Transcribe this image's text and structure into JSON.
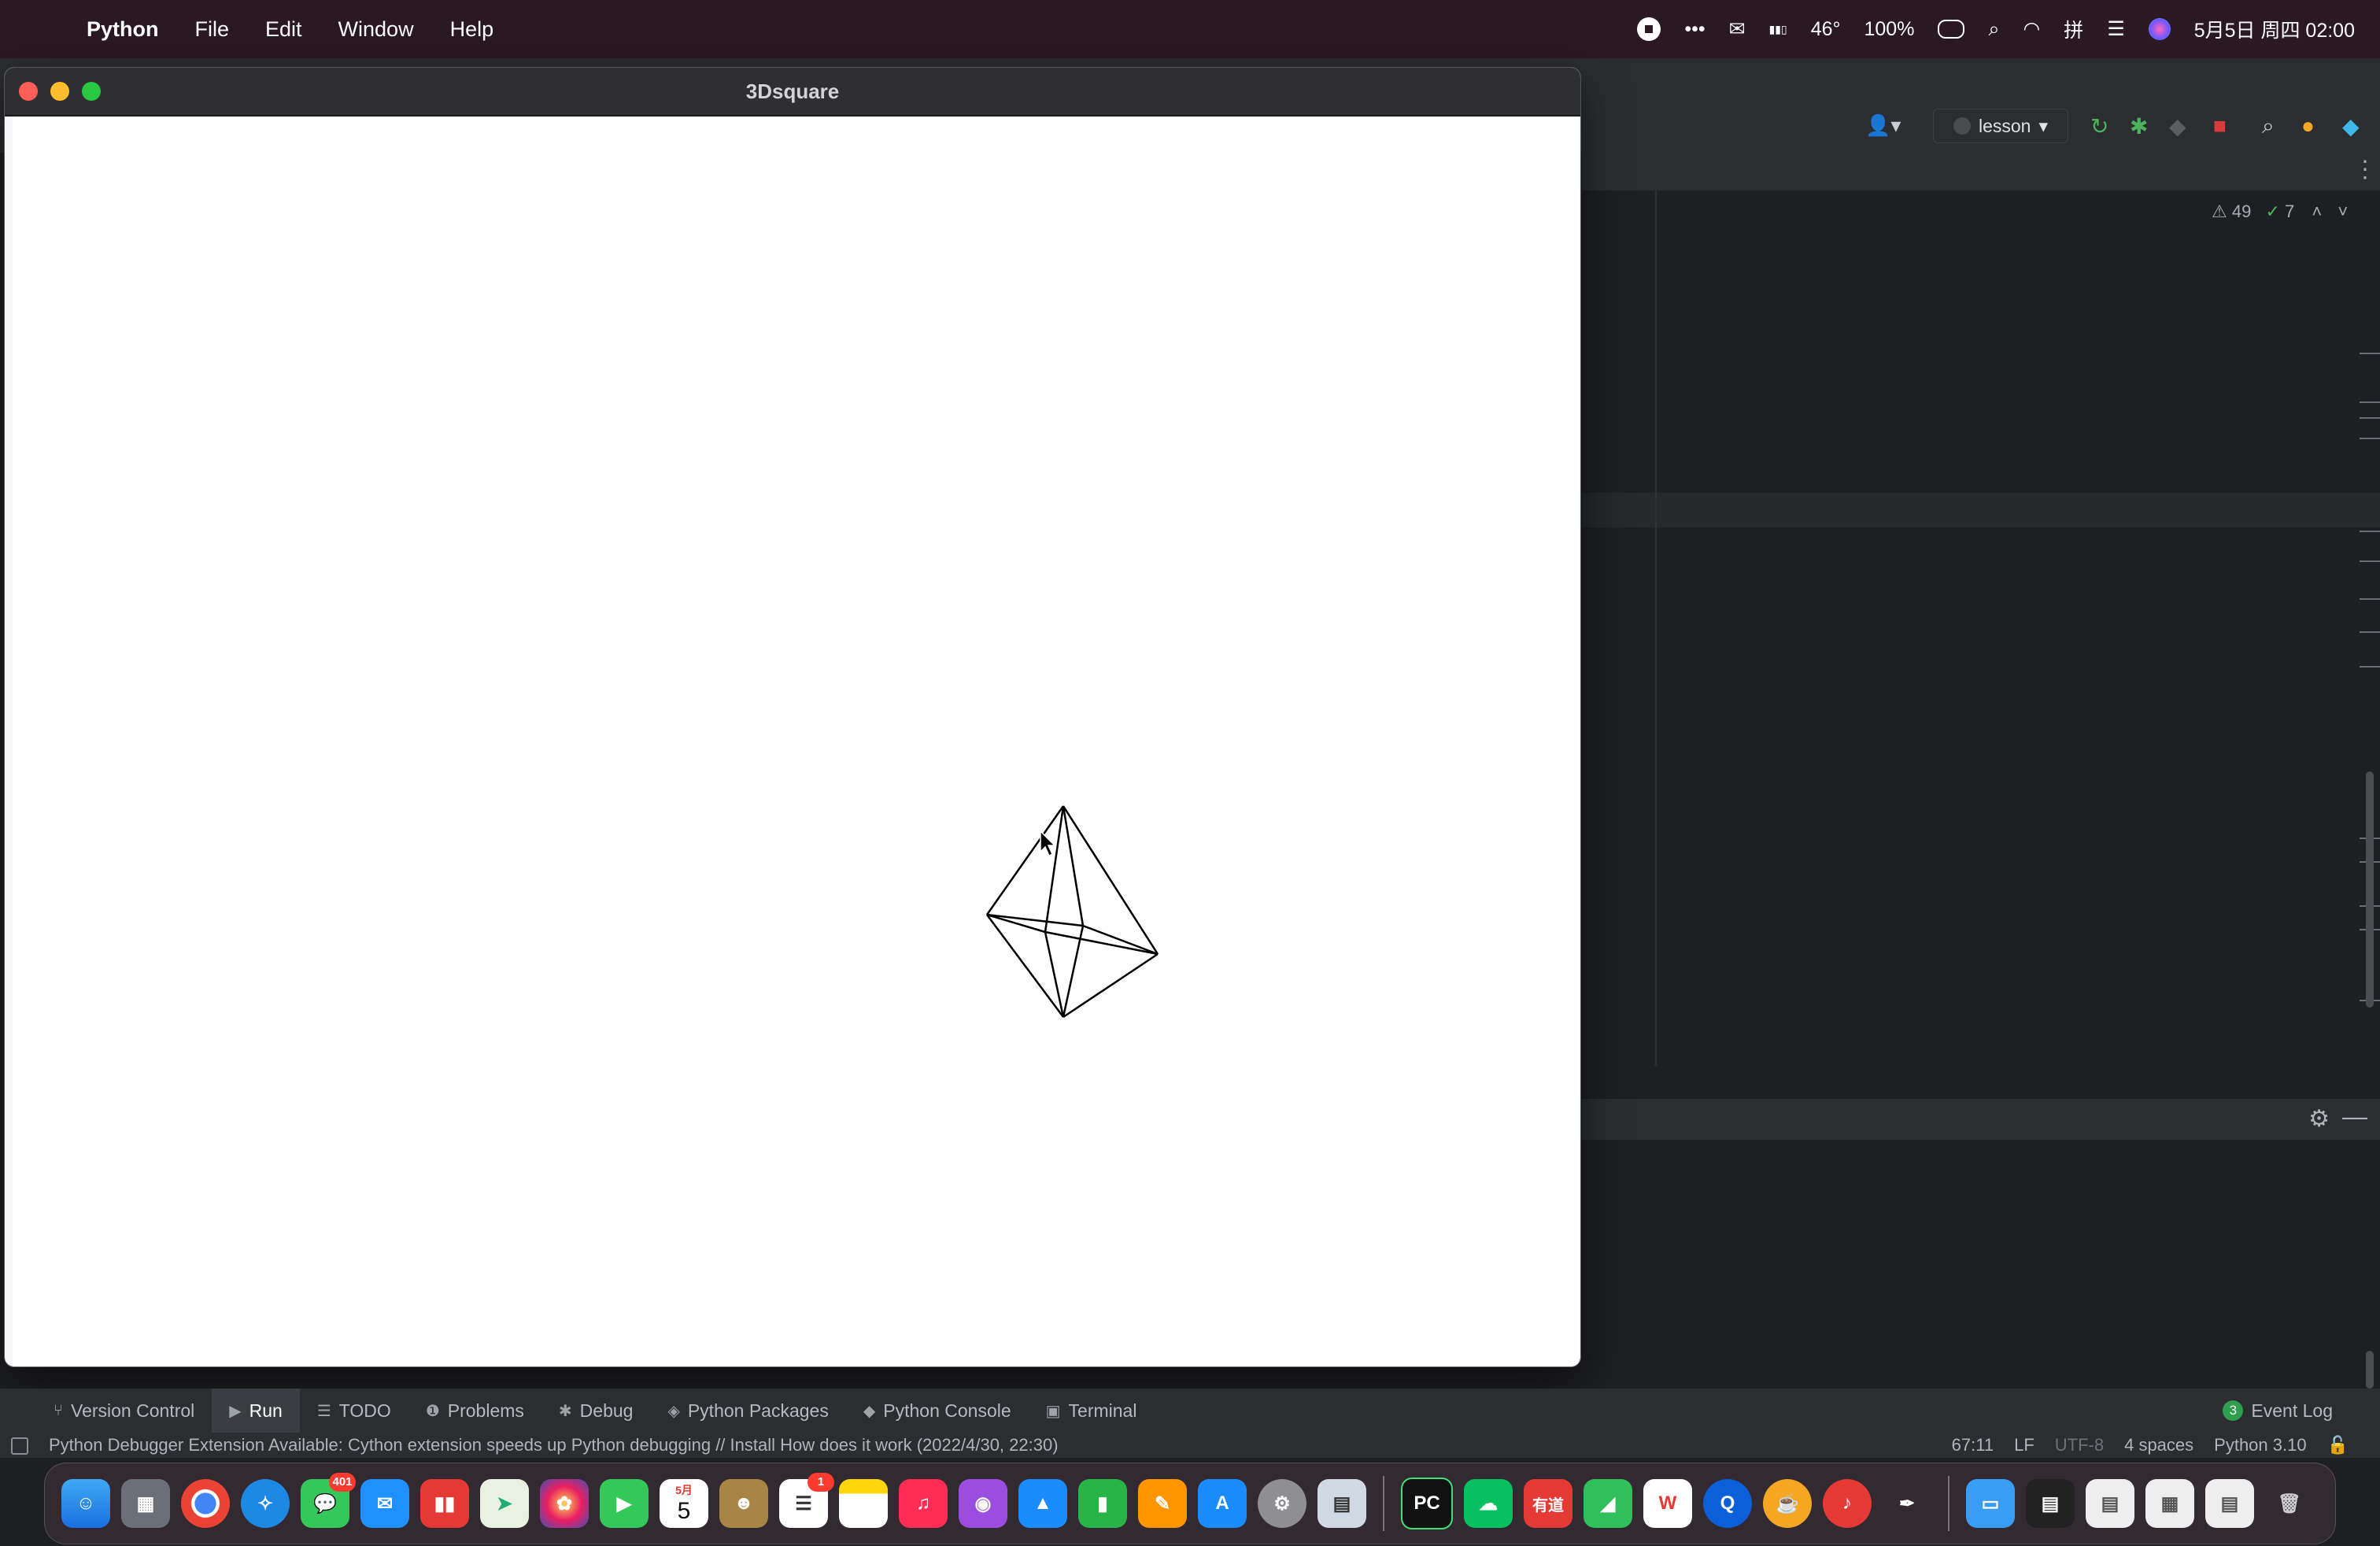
{
  "menubar": {
    "app": "Python",
    "items": [
      "File",
      "Edit",
      "Window",
      "Help"
    ],
    "temp": "46°",
    "battery": "100%",
    "datetime": "5月5日 周四 02:00"
  },
  "window": {
    "title": "3Dsquare"
  },
  "ide": {
    "run_config": "lesson",
    "warnings": "49",
    "checks": "7"
  },
  "toolwindows": {
    "version_control": "Version Control",
    "run": "Run",
    "todo": "TODO",
    "problems": "Problems",
    "debug": "Debug",
    "python_packages": "Python Packages",
    "python_console": "Python Console",
    "terminal": "Terminal",
    "event_log": "Event Log",
    "event_count": "3"
  },
  "statusbar": {
    "message": "Python Debugger Extension Available: Cython extension speeds up Python debugging // Install   How does it work (2022/4/30, 22:30)",
    "position": "67:11",
    "line_sep": "LF",
    "encoding": "UTF-8",
    "indent": "4 spaces",
    "interpreter": "Python 3.10"
  },
  "dock": {
    "messages_badge": "401",
    "calendar_month": "5月",
    "calendar_day": "5",
    "reminders_badge": "1",
    "pycharm_label": "PC",
    "youdao_label": "有道",
    "wps_label": "W"
  },
  "colors": {
    "menubar": "#2a1822",
    "ide_bg": "#1e1f22",
    "canvas": "#ffffff"
  }
}
